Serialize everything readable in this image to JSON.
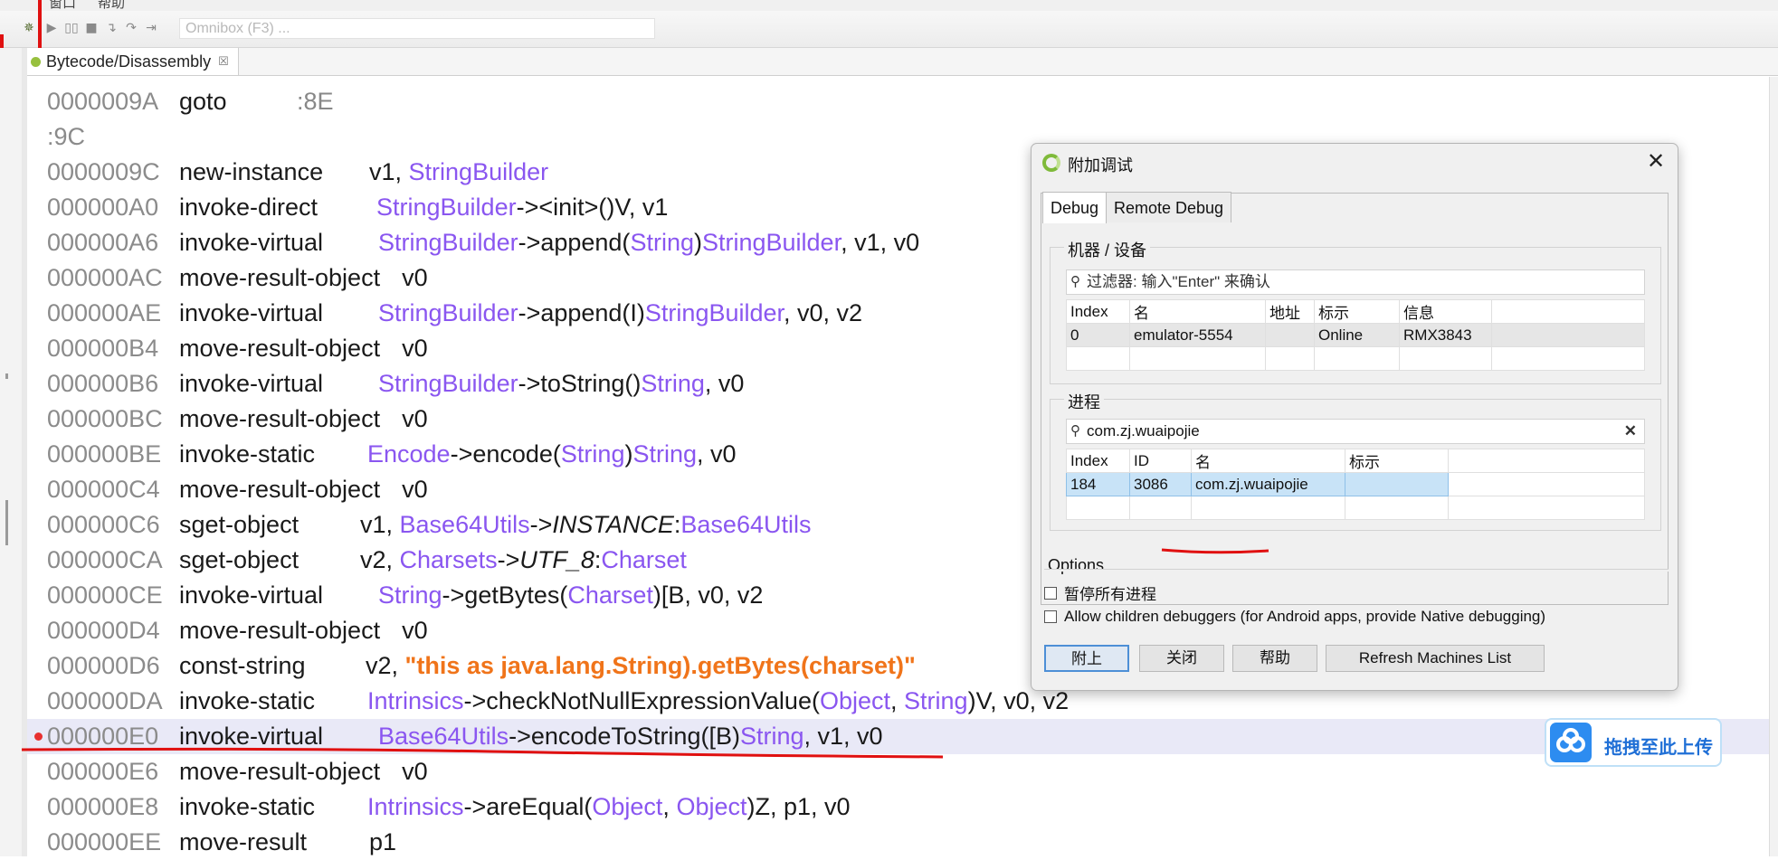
{
  "menu": {
    "items": [
      "窗口",
      "帮助"
    ]
  },
  "toolbar": {
    "icons": [
      "debug-icon",
      "run-icon",
      "pause-icon",
      "stop-icon",
      "step-into-icon",
      "step-over-icon",
      "step-out-icon"
    ],
    "omnibox_placeholder": "Omnibox (F3) ..."
  },
  "editor": {
    "tab_label": "Bytecode/Disassembly",
    "tab_close": "☒"
  },
  "code_lines": [
    {
      "addr": "0000009A",
      "op": "goto",
      "args": [
        {
          "t": ":8E",
          "c": "lbl"
        }
      ]
    },
    {
      "addr": ":9C",
      "op": "",
      "args": []
    },
    {
      "addr": "0000009C",
      "op": "new-instance",
      "args": [
        {
          "t": "v1, "
        },
        {
          "t": "StringBuilder",
          "c": "k"
        }
      ]
    },
    {
      "addr": "000000A0",
      "op": "invoke-direct",
      "args": [
        {
          "t": "StringBuilder",
          "c": "k"
        },
        {
          "t": "-><init>()V, v1"
        }
      ]
    },
    {
      "addr": "000000A6",
      "op": "invoke-virtual",
      "args": [
        {
          "t": "StringBuilder",
          "c": "k"
        },
        {
          "t": "->append("
        },
        {
          "t": "String",
          "c": "k"
        },
        {
          "t": ")"
        },
        {
          "t": "StringBuilder",
          "c": "k"
        },
        {
          "t": ", v1, v0"
        }
      ]
    },
    {
      "addr": "000000AC",
      "op": "move-result-object",
      "args": [
        {
          "t": "v0"
        }
      ]
    },
    {
      "addr": "000000AE",
      "op": "invoke-virtual",
      "args": [
        {
          "t": "StringBuilder",
          "c": "k"
        },
        {
          "t": "->append(I)"
        },
        {
          "t": "StringBuilder",
          "c": "k"
        },
        {
          "t": ", v0, v2"
        }
      ]
    },
    {
      "addr": "000000B4",
      "op": "move-result-object",
      "args": [
        {
          "t": "v0"
        }
      ]
    },
    {
      "addr": "000000B6",
      "op": "invoke-virtual",
      "args": [
        {
          "t": "StringBuilder",
          "c": "k"
        },
        {
          "t": "->toString()"
        },
        {
          "t": "String",
          "c": "k"
        },
        {
          "t": ", v0"
        }
      ]
    },
    {
      "addr": "000000BC",
      "op": "move-result-object",
      "args": [
        {
          "t": "v0"
        }
      ]
    },
    {
      "addr": "000000BE",
      "op": "invoke-static",
      "args": [
        {
          "t": "Encode",
          "c": "k"
        },
        {
          "t": "->encode("
        },
        {
          "t": "String",
          "c": "k"
        },
        {
          "t": ")"
        },
        {
          "t": "String",
          "c": "k"
        },
        {
          "t": ", v0"
        }
      ]
    },
    {
      "addr": "000000C4",
      "op": "move-result-object",
      "args": [
        {
          "t": "v0"
        }
      ]
    },
    {
      "addr": "000000C6",
      "op": "sget-object",
      "args": [
        {
          "t": "v1, "
        },
        {
          "t": "Base64Utils",
          "c": "k"
        },
        {
          "t": "->"
        },
        {
          "t": "INSTANCE",
          "c": "it"
        },
        {
          "t": ":"
        },
        {
          "t": "Base64Utils",
          "c": "k"
        }
      ]
    },
    {
      "addr": "000000CA",
      "op": "sget-object",
      "args": [
        {
          "t": "v2, "
        },
        {
          "t": "Charsets",
          "c": "k"
        },
        {
          "t": "->"
        },
        {
          "t": "UTF_8",
          "c": "it"
        },
        {
          "t": ":"
        },
        {
          "t": "Charset",
          "c": "k"
        }
      ]
    },
    {
      "addr": "000000CE",
      "op": "invoke-virtual",
      "args": [
        {
          "t": "String",
          "c": "k"
        },
        {
          "t": "->getBytes("
        },
        {
          "t": "Charset",
          "c": "k"
        },
        {
          "t": ")[B, v0, v2"
        }
      ]
    },
    {
      "addr": "000000D4",
      "op": "move-result-object",
      "args": [
        {
          "t": "v0"
        }
      ]
    },
    {
      "addr": "000000D6",
      "op": "const-string",
      "args": [
        {
          "t": "v2, "
        },
        {
          "t": "\"this as java.lang.String).getBytes(charset)\"",
          "c": "str"
        }
      ]
    },
    {
      "addr": "000000DA",
      "op": "invoke-static",
      "args": [
        {
          "t": "Intrinsics",
          "c": "k"
        },
        {
          "t": "->checkNotNullExpressionValue("
        },
        {
          "t": "Object",
          "c": "k"
        },
        {
          "t": ", "
        },
        {
          "t": "String",
          "c": "k"
        },
        {
          "t": ")V, v0, v2"
        }
      ]
    },
    {
      "addr": "000000E0",
      "op": "invoke-virtual",
      "hl": true,
      "args": [
        {
          "t": "Base64Utils",
          "c": "k"
        },
        {
          "t": "->encodeToString([B)"
        },
        {
          "t": "String",
          "c": "k"
        },
        {
          "t": ", v1, v0"
        }
      ]
    },
    {
      "addr": "000000E6",
      "op": "move-result-object",
      "args": [
        {
          "t": "v0"
        }
      ]
    },
    {
      "addr": "000000E8",
      "op": "invoke-static",
      "args": [
        {
          "t": "Intrinsics",
          "c": "k"
        },
        {
          "t": "->areEqual("
        },
        {
          "t": "Object",
          "c": "k"
        },
        {
          "t": ", "
        },
        {
          "t": "Object",
          "c": "k"
        },
        {
          "t": ")Z, p1, v0"
        }
      ]
    },
    {
      "addr": "000000EE",
      "op": "move-result",
      "args": [
        {
          "t": "p1"
        }
      ]
    }
  ],
  "dialog": {
    "title": "附加调试",
    "close": "✕",
    "tabs": {
      "debug": "Debug",
      "remote": "Remote Debug"
    },
    "devices": {
      "label": "机器 / 设备",
      "filter_placeholder": "过滤器: 输入\"Enter\" 来确认",
      "columns": [
        "Index",
        "名",
        "地址",
        "标示",
        "信息"
      ],
      "rows": [
        [
          "0",
          "emulator-5554",
          "",
          "Online",
          "RMX3843"
        ]
      ]
    },
    "process": {
      "label": "进程",
      "filter_value": "com.zj.wuaipojie",
      "columns": [
        "Index",
        "ID",
        "名",
        "标示"
      ],
      "rows": [
        [
          "184",
          "3086",
          "com.zj.wuaipojie",
          ""
        ]
      ]
    },
    "options": {
      "label": "Options",
      "pause_all": "暂停所有进程",
      "allow_children": "Allow children debuggers (for Android apps, provide Native debugging)"
    },
    "buttons": {
      "attach": "附上",
      "close": "关闭",
      "help": "帮助",
      "refresh": "Refresh Machines List"
    }
  },
  "upload_badge": {
    "label": "拖拽至此上传"
  },
  "colors": {
    "keyword": "#8a56f0",
    "string": "#f0741a",
    "annotation": "#e01010",
    "selection": "#c8e3f7"
  }
}
